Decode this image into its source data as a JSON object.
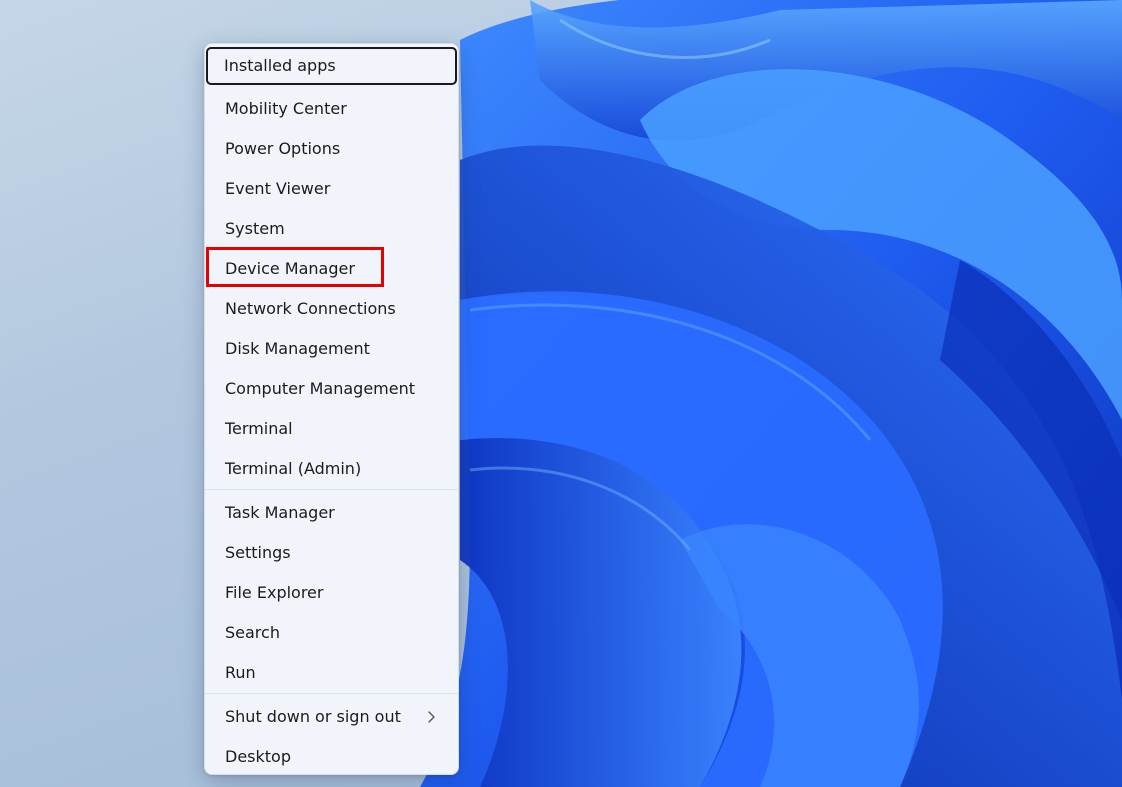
{
  "menu": {
    "group1": [
      {
        "label": "Installed apps"
      },
      {
        "label": "Mobility Center"
      },
      {
        "label": "Power Options"
      },
      {
        "label": "Event Viewer"
      },
      {
        "label": "System"
      },
      {
        "label": "Device Manager"
      },
      {
        "label": "Network Connections"
      },
      {
        "label": "Disk Management"
      },
      {
        "label": "Computer Management"
      },
      {
        "label": "Terminal"
      },
      {
        "label": "Terminal (Admin)"
      }
    ],
    "group2": [
      {
        "label": "Task Manager"
      },
      {
        "label": "Settings"
      },
      {
        "label": "File Explorer"
      },
      {
        "label": "Search"
      },
      {
        "label": "Run"
      }
    ],
    "group3": [
      {
        "label": "Shut down or sign out",
        "submenu_icon": "chevron-right-icon"
      },
      {
        "label": "Desktop"
      }
    ]
  },
  "colors": {
    "highlight_box": "#e60000",
    "wallpaper_blue": "#1f5cf0"
  }
}
